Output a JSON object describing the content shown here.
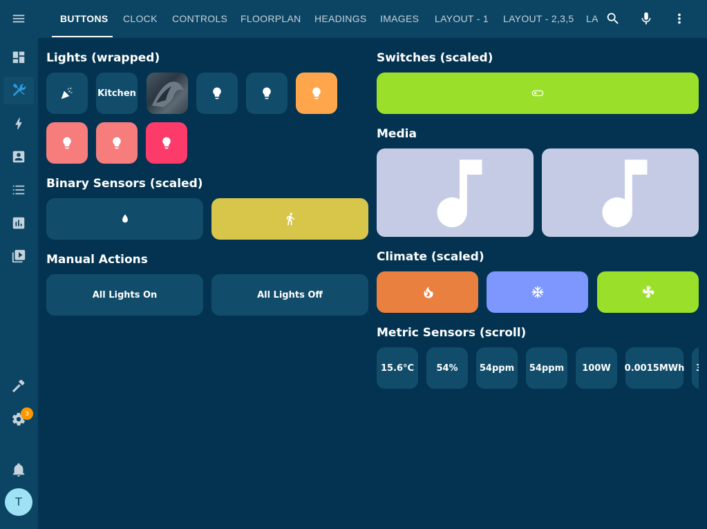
{
  "header": {
    "tabs": [
      {
        "label": "BUTTONS",
        "active": true
      },
      {
        "label": "CLOCK"
      },
      {
        "label": "CONTROLS"
      },
      {
        "label": "FLOORPLAN"
      },
      {
        "label": "HEADINGS"
      },
      {
        "label": "IMAGES"
      },
      {
        "label": "LAYOUT - 1"
      },
      {
        "label": "LAYOUT - 2,3,5"
      },
      {
        "label": "LA"
      }
    ],
    "icons": [
      "search-icon",
      "microphone-icon",
      "more-vertical-icon"
    ]
  },
  "sidebar": {
    "items": [
      {
        "icon": "menu-icon"
      },
      {
        "icon": "dashboard-icon"
      },
      {
        "icon": "tools-icon",
        "active": true
      },
      {
        "icon": "energy-icon"
      },
      {
        "icon": "contact-card-icon"
      },
      {
        "icon": "list-icon"
      },
      {
        "icon": "chart-icon"
      },
      {
        "icon": "media-play-icon"
      },
      {
        "icon": "hammer-icon"
      },
      {
        "icon": "settings-icon",
        "badge": "3"
      },
      {
        "icon": "bell-icon"
      }
    ],
    "avatar": "T"
  },
  "sections": {
    "lights_title": "Lights (wrapped)",
    "switches_title": "Switches (scaled)",
    "media_title": "Media",
    "binary_title": "Binary Sensors (scaled)",
    "climate_title": "Climate (scaled)",
    "manual_title": "Manual Actions",
    "metric_title": "Metric Sensors (scroll)"
  },
  "lights": {
    "kitchen_label": "Kitchen",
    "tiles": [
      {
        "icon": "party-popper-icon",
        "color": "#114d6a"
      },
      {
        "label": "Kitchen",
        "color": "#114d6a"
      },
      {
        "icon": "photo",
        "color": "#3a4752"
      },
      {
        "icon": "lightbulb-icon",
        "color": "#114d6a"
      },
      {
        "icon": "lightbulb-icon",
        "color": "#114d6a"
      },
      {
        "icon": "lightbulb-icon",
        "color": "#ffa64c"
      },
      {
        "icon": "lightbulb-icon",
        "color": "#f77d7d"
      },
      {
        "icon": "lightbulb-icon",
        "color": "#f77d7d"
      },
      {
        "icon": "lightbulb-icon",
        "color": "#fc3b6a"
      }
    ]
  },
  "switches": {
    "icon": "toggle-switch-icon",
    "color": "#9ae02b"
  },
  "media": {
    "icon": "music-note-icon",
    "color": "#c5cbe5"
  },
  "binary": [
    {
      "icon": "water-drop-icon",
      "color": "#114d6a"
    },
    {
      "icon": "walking-icon",
      "color": "#d8c64b"
    }
  ],
  "climate": [
    {
      "icon": "fire-icon",
      "color": "#e98040"
    },
    {
      "icon": "snowflake-icon",
      "color": "#7d97ff"
    },
    {
      "icon": "ac-fan-icon",
      "color": "#9ae02b"
    }
  ],
  "manual": {
    "on_label": "All Lights On",
    "off_label": "All Lights Off"
  },
  "metrics": [
    "15.6°C",
    "54%",
    "54ppm",
    "54ppm",
    "100W",
    "0.0015MWh",
    "3"
  ]
}
